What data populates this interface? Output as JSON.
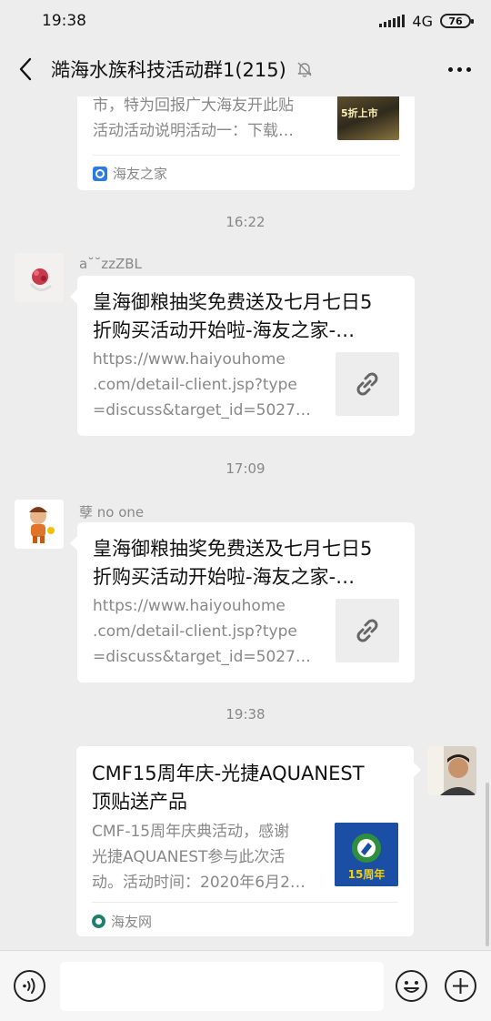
{
  "status_bar": {
    "time": "19:38",
    "network": "4G",
    "battery": "76"
  },
  "header": {
    "title": "澔海水族科技活动群1(215)",
    "icons": [
      "back-arrow-icon",
      "muted-bell-icon",
      "more-dots-icon"
    ]
  },
  "messages": [
    {
      "type": "article",
      "title_partial": "",
      "description": [
        "市，特为回报广大海友开此贴",
        "活动活动说明活动一：下载…"
      ],
      "thumb_text": "5折上市",
      "source": "海友之家"
    },
    {
      "timestamp": "16:22",
      "sender": "a˘˘zzZBL",
      "type": "link",
      "title": [
        "皇海御粮抽奖免费送及七月七日5",
        "折购买活动开始啦-海友之家-…"
      ],
      "url": [
        "https://www.haiyouhome",
        ".com/detail-client.jsp?type",
        "=discuss&target_id=5027…"
      ]
    },
    {
      "timestamp": "17:09",
      "sender": "孽 no one",
      "type": "link",
      "title": [
        "皇海御粮抽奖免费送及七月七日5",
        "折购买活动开始啦-海友之家-…"
      ],
      "url": [
        "https://www.haiyouhome",
        ".com/detail-client.jsp?type",
        "=discuss&target_id=5027…"
      ]
    },
    {
      "timestamp": "19:38",
      "sender": "",
      "type": "article",
      "title": [
        "CMF15周年庆-光捷AQUANEST",
        "顶贴送产品"
      ],
      "description": [
        "CMF-15周年庆典活动，感谢",
        "光捷AQUANEST参与此次活",
        "动。活动时间：2020年6月2…"
      ],
      "thumb_text": "15周年",
      "source": "海友网"
    }
  ],
  "input_bar": {
    "placeholder": "",
    "icons": [
      "voice-icon",
      "emoji-icon",
      "plus-icon"
    ]
  },
  "colors": {
    "background": "#ededed",
    "card": "#ffffff",
    "muted_text": "#888888"
  }
}
